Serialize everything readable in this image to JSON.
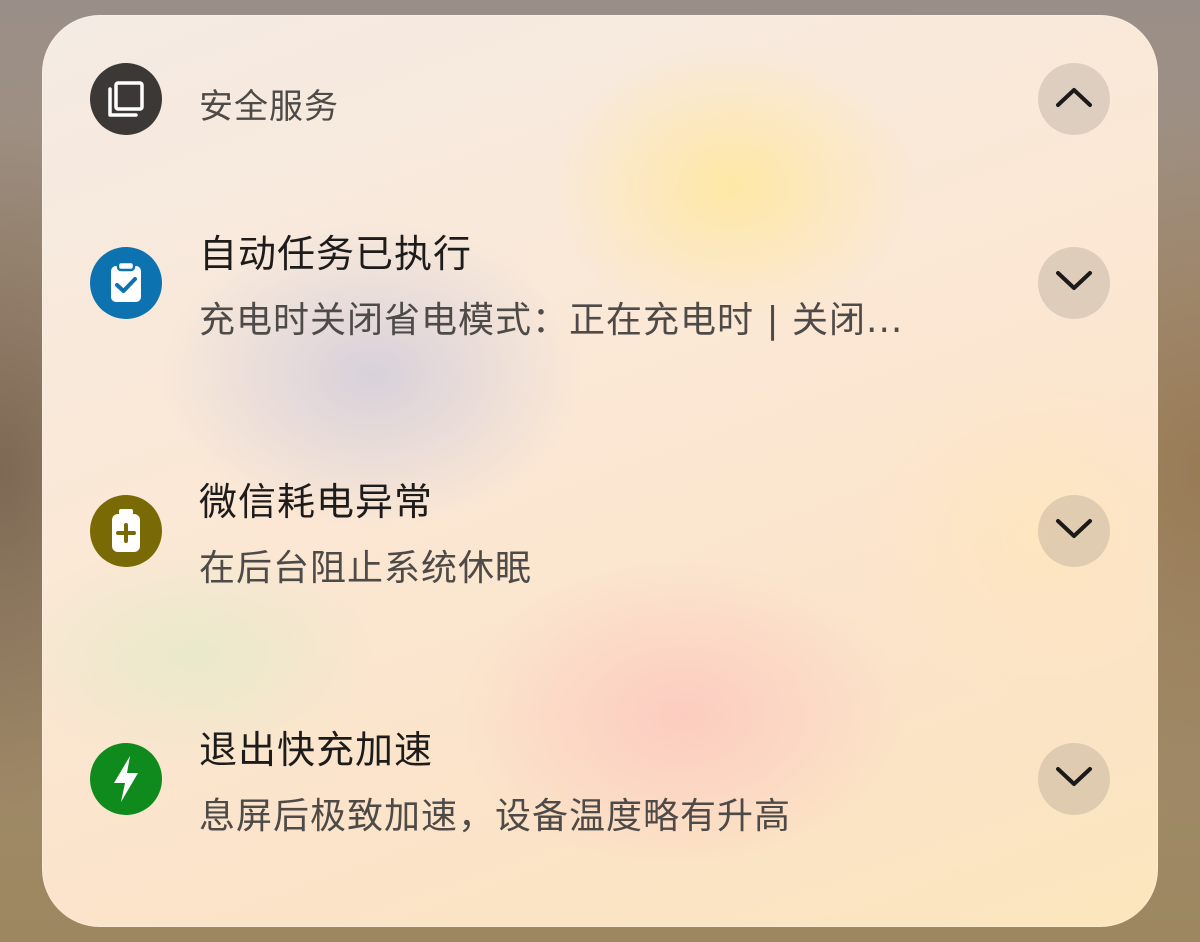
{
  "header": {
    "title": "安全服务",
    "app_icon": "copy-icon",
    "toggle_icon": "chevron-up-icon"
  },
  "notifications": [
    {
      "title": "自动任务已执行",
      "subtitle": "充电时关闭省电模式：正在充电时 | 关闭...",
      "icon": "clipboard-check-icon",
      "icon_color": "#0d73b0",
      "expand_icon": "chevron-down-icon"
    },
    {
      "title": "微信耗电异常",
      "subtitle": "在后台阻止系统休眠",
      "icon": "battery-plus-icon",
      "icon_color": "#7a6a05",
      "expand_icon": "chevron-down-icon"
    },
    {
      "title": "退出快充加速",
      "subtitle": "息屏后极致加速，设备温度略有升高",
      "icon": "lightning-bolt-icon",
      "icon_color": "#0f8a1c",
      "expand_icon": "chevron-down-icon"
    }
  ],
  "colors": {
    "header_icon_bg": "#3b3835",
    "button_bg": "rgba(150,140,130,0.28)"
  }
}
